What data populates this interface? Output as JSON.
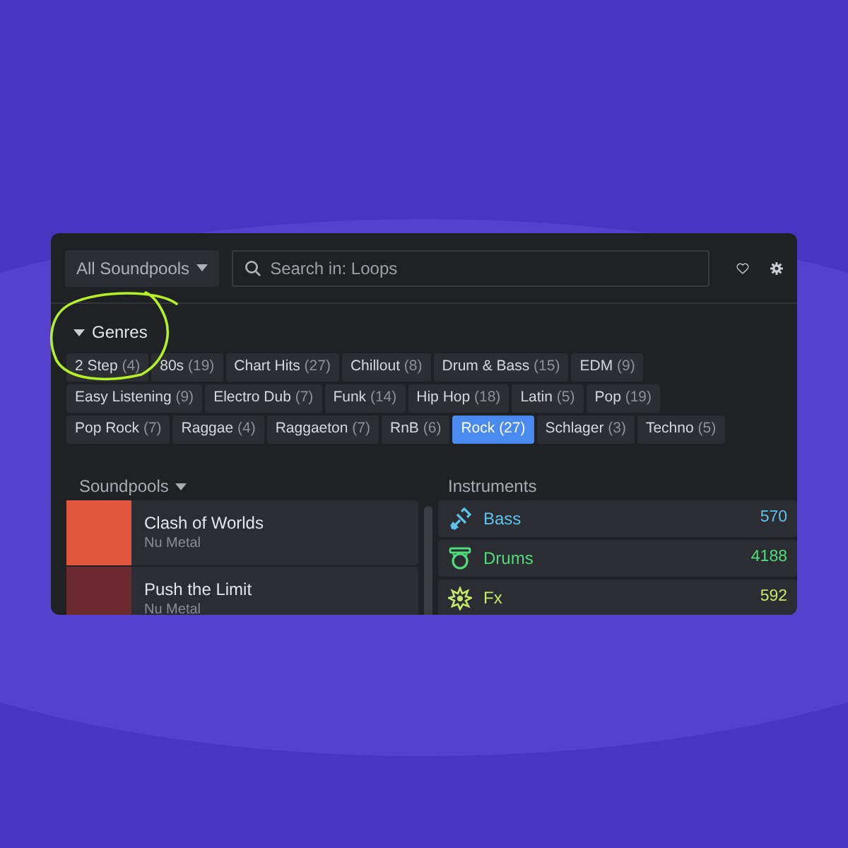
{
  "toolbar": {
    "dropdown": "All Soundpools",
    "search": {
      "placeholder": "Search in: Loops"
    }
  },
  "genres": {
    "title": "Genres",
    "expanded": true,
    "tags": [
      {
        "label": "2 Step",
        "count": "(4)",
        "selected": false
      },
      {
        "label": "80s",
        "count": "(19)",
        "selected": false
      },
      {
        "label": "Chart Hits",
        "count": "(27)",
        "selected": false
      },
      {
        "label": "Chillout",
        "count": "(8)",
        "selected": false
      },
      {
        "label": "Drum & Bass",
        "count": "(15)",
        "selected": false
      },
      {
        "label": "EDM",
        "count": "(9)",
        "selected": false
      },
      {
        "label": "Easy Listening",
        "count": "(9)",
        "selected": false
      },
      {
        "label": "Electro Dub",
        "count": "(7)",
        "selected": false
      },
      {
        "label": "Funk",
        "count": "(14)",
        "selected": false
      },
      {
        "label": "Hip Hop",
        "count": "(18)",
        "selected": false
      },
      {
        "label": "Latin",
        "count": "(5)",
        "selected": false
      },
      {
        "label": "Pop",
        "count": "(19)",
        "selected": false
      },
      {
        "label": "Pop Rock",
        "count": "(7)",
        "selected": false
      },
      {
        "label": "Raggae",
        "count": "(4)",
        "selected": false
      },
      {
        "label": "Raggaeton",
        "count": "(7)",
        "selected": false
      },
      {
        "label": "RnB",
        "count": "(6)",
        "selected": false
      },
      {
        "label": "Rock",
        "count": "(27)",
        "selected": true
      },
      {
        "label": "Schlager",
        "count": "(3)",
        "selected": false
      },
      {
        "label": "Techno",
        "count": "(5)",
        "selected": false
      }
    ]
  },
  "soundpools": {
    "title": "Soundpools",
    "items": [
      {
        "name": "Clash of Worlds",
        "genre": "Nu Metal"
      },
      {
        "name": "Push the Limit",
        "genre": "Nu Metal"
      }
    ]
  },
  "instruments": {
    "title": "Instruments",
    "items": [
      {
        "kind": "bass",
        "name": "Bass",
        "count": "570",
        "color": "#5cc3ec"
      },
      {
        "kind": "drums",
        "name": "Drums",
        "count": "4188",
        "color": "#4fdc7a"
      },
      {
        "kind": "fx",
        "name": "Fx",
        "count": "592",
        "color": "#c6e86a"
      }
    ]
  }
}
